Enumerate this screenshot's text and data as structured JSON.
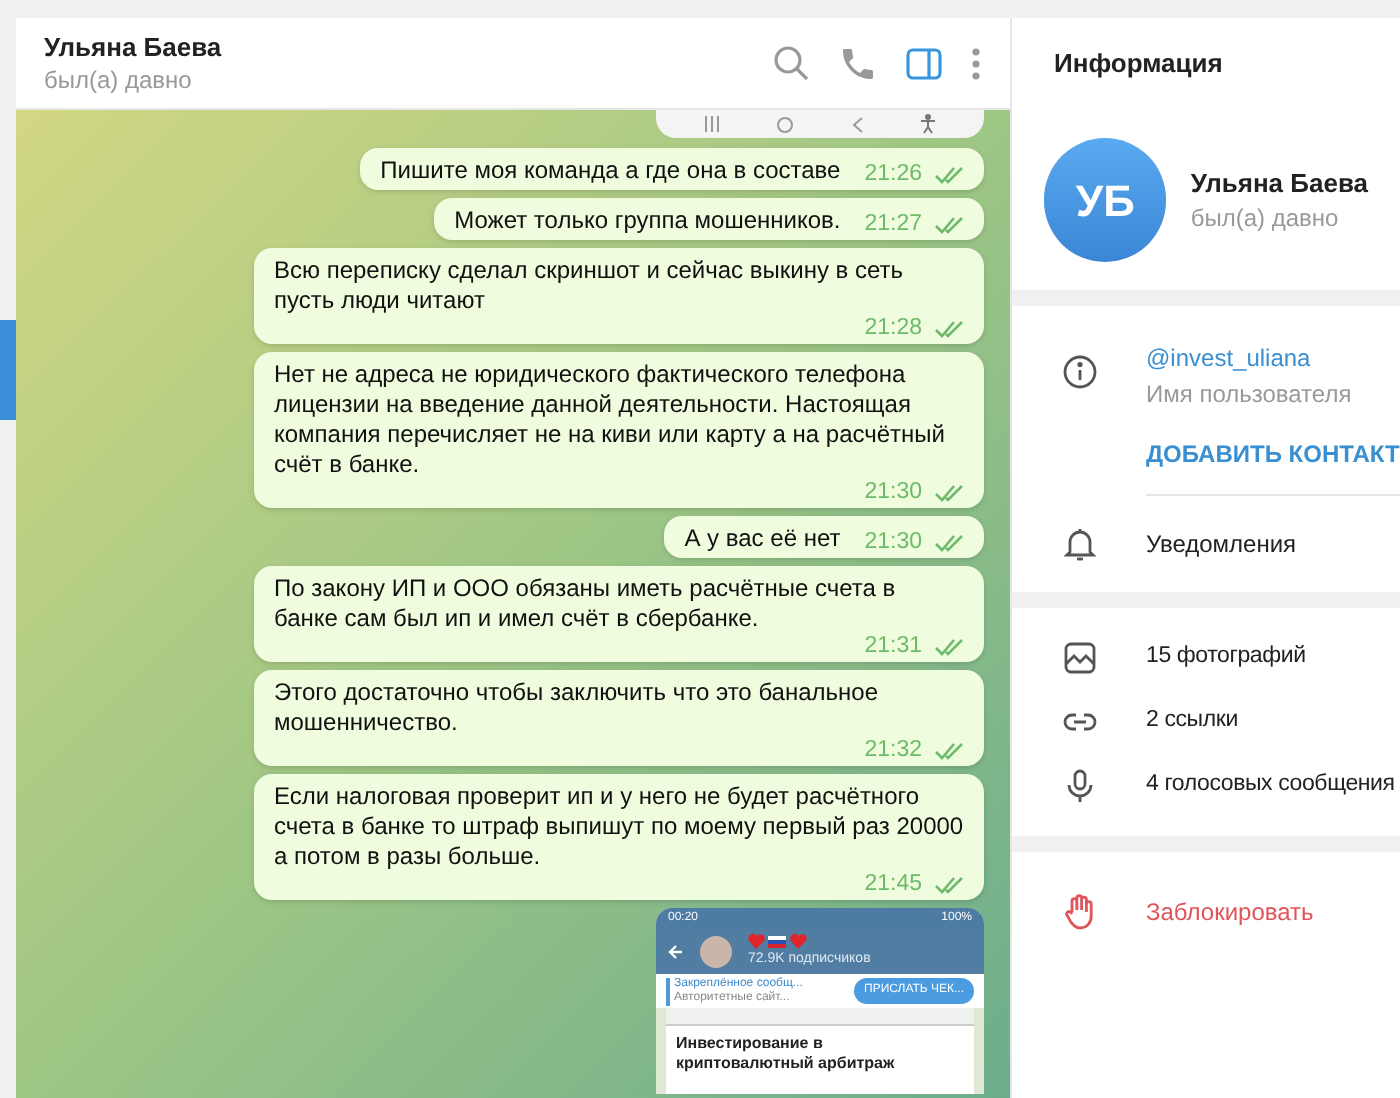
{
  "chat_header": {
    "name": "Ульяна Баева",
    "status": "был(а) давно",
    "info_panel_open": true
  },
  "messages": [
    {
      "text": "Пишите моя команда а где она в составе",
      "time": "21:26",
      "read": true
    },
    {
      "text": "Может только группа мошенников.",
      "time": "21:27",
      "read": true
    },
    {
      "text": "Всю переписку сделал скриншот и сейчас выкину в сеть пусть люди читают",
      "time": "21:28",
      "read": true
    },
    {
      "text": "Нет не адреса не юридического фактического телефона лицензии на введение данной деятельности. Настоящая компания перечисляет не на киви или карту а на расчётный счёт в банке.",
      "time": "21:30",
      "read": true
    },
    {
      "text": "А у вас её нет",
      "time": "21:30",
      "read": true
    },
    {
      "text": "По закону ИП и ООО обязаны иметь расчётные счета в банке сам был ип и имел счёт в сбербанке.",
      "time": "21:31",
      "read": true
    },
    {
      "text": "Этого достаточно чтобы заключить что это банальное мошенничество.",
      "time": "21:32",
      "read": true
    },
    {
      "text": "Если налоговая проверит ип и у него не будет расчётного счета в банке то штраф выпишут по моему первый раз 20000 а потом в разы больше.",
      "time": "21:45",
      "read": true
    }
  ],
  "shared_screenshot": {
    "clock": "00:20",
    "battery": "100%",
    "subscribers": "72.9K подписчиков",
    "pinned_title": "Закреплённое сообщ...",
    "pinned_text": "Авторитетные сайт...",
    "pinned_button": "ПРИСЛАТЬ ЧЕК...",
    "post_title": "Инвестирование в криптовалютный арбитраж"
  },
  "info_panel": {
    "title": "Информация",
    "initials": "УБ",
    "name": "Ульяна Баева",
    "status": "был(а) давно",
    "username": "@invest_uliana",
    "username_label": "Имя пользователя",
    "add_contact": "ДОБАВИТЬ КОНТАКТ",
    "notifications": "Уведомления",
    "media": [
      {
        "kind": "photos",
        "label": "15 фотографий"
      },
      {
        "kind": "links",
        "label": "2 ссылки"
      },
      {
        "kind": "voice",
        "label": "4 голосовых сообщения"
      }
    ],
    "block": "Заблокировать"
  }
}
